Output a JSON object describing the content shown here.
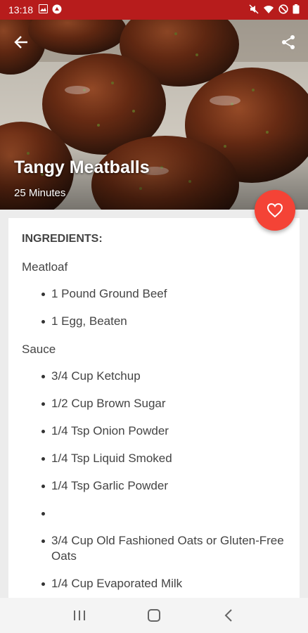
{
  "status_bar": {
    "time": "13:18",
    "left_icons": [
      "image-icon",
      "notification-icon"
    ],
    "right_icons": [
      "mute-icon",
      "wifi-icon",
      "do-not-disturb-icon",
      "battery-icon"
    ]
  },
  "recipe": {
    "title": "Tangy Meatballs",
    "duration": "25 Minutes"
  },
  "ingredients": {
    "heading": "INGREDIENTS:",
    "groups": [
      {
        "label": "Meatloaf",
        "items": [
          "1 Pound Ground Beef",
          "1 Egg, Beaten"
        ]
      },
      {
        "label": "Sauce",
        "items": [
          "3/4 Cup Ketchup",
          "1/2 Cup Brown Sugar",
          "1/4 Tsp Onion Powder",
          "1/4 Tsp Liquid Smoked",
          "1/4 Tsp Garlic Powder",
          "",
          "3/4 Cup Old Fashioned Oats or Gluten-Free Oats",
          "1/4 Cup Evaporated Milk"
        ]
      }
    ]
  },
  "icons": {
    "back": "arrow-back-icon",
    "share": "share-icon",
    "favorite": "heart-outline-icon",
    "nav_recents": "recents-icon",
    "nav_home": "home-icon",
    "nav_back": "back-icon"
  },
  "colors": {
    "status_bar": "#b71c1c",
    "fab": "#f44336",
    "text": "#444444"
  }
}
